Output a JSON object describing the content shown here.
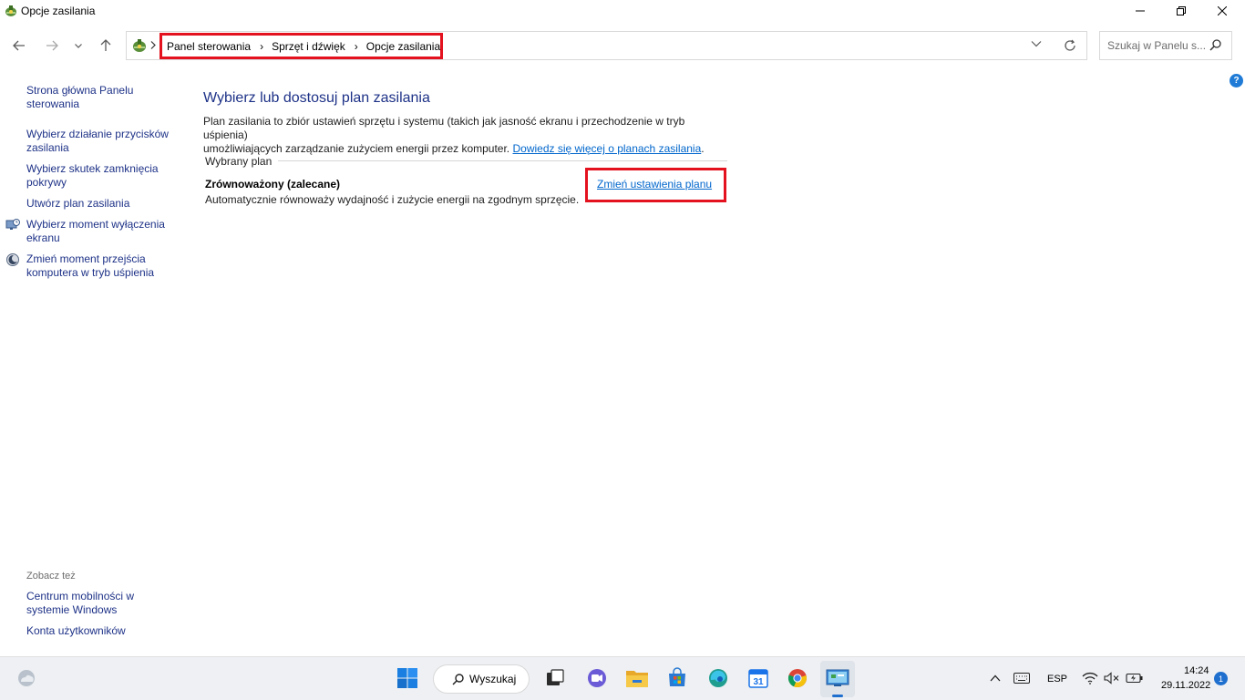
{
  "window": {
    "title": "Opcje zasilania",
    "app_icon": "power-options-icon",
    "controls": [
      "minimize-icon",
      "restore-icon",
      "close-icon"
    ]
  },
  "navigation": {
    "back": "back-arrow-icon",
    "forward": "forward-arrow-icon",
    "recent": "chevron-down-icon",
    "up": "up-arrow-icon"
  },
  "address": {
    "crumbs": [
      "Panel sterowania",
      "Sprzęt i dźwięk",
      "Opcje zasilania"
    ],
    "separator": "›",
    "highlight_color": "#e3121e"
  },
  "search": {
    "placeholder": "Szukaj w Panelu s..."
  },
  "help": {
    "label": "?"
  },
  "sidebar": {
    "items": [
      {
        "label_line1": "Strona główna Panelu",
        "label_line2": "sterowania",
        "icon": ""
      },
      {
        "label_line1": "Wybierz działanie przycisków",
        "label_line2": "zasilania",
        "icon": ""
      },
      {
        "label_line1": "Wybierz skutek zamknięcia",
        "label_line2": "pokrywy",
        "icon": ""
      },
      {
        "label_line1": "Utwórz plan zasilania",
        "label_line2": "",
        "icon": ""
      },
      {
        "label_line1": "Wybierz moment wyłączenia",
        "label_line2": "ekranu",
        "icon": "display-clock-icon"
      },
      {
        "label_line1": "Zmień moment przejścia",
        "label_line2": "komputera w tryb uśpienia",
        "icon": "sleep-moon-icon"
      }
    ],
    "see_also": "Zobacz też",
    "see_also_items": [
      {
        "label_line1": "Centrum mobilności w",
        "label_line2": "systemie Windows"
      },
      {
        "label_line1": "Konta użytkowników",
        "label_line2": ""
      }
    ]
  },
  "main": {
    "heading": "Wybierz lub dostosuj plan zasilania",
    "description_line1": "Plan zasilania to zbiór ustawień sprzętu i systemu (takich jak jasność ekranu i przechodzenie w tryb uśpienia)",
    "description_line2": "umożliwiających zarządzanie zużyciem energii przez komputer.",
    "learn_more": "Dowiedz się więcej o planach zasilania",
    "learn_more_suffix": ".",
    "group_label": "Wybrany plan",
    "plan": {
      "name": "Zrównoważony (zalecane)",
      "description": "Automatycznie równoważy wydajność i zużycie energii na zgodnym sprzęcie.",
      "change_link": "Zmień ustawienia planu"
    }
  },
  "taskbar": {
    "weather_icon": "weather-icon",
    "start_icon": "windows-start-icon",
    "search_label": "Wyszukaj",
    "apps": [
      "task-view-icon",
      "teams-chat-icon",
      "file-explorer-icon",
      "microsoft-store-icon",
      "edge-icon",
      "calendar-icon",
      "chrome-icon",
      "control-panel-icon"
    ],
    "calendar_day": "31",
    "tray": {
      "chevron": "chevron-up-icon",
      "keyboard": "keyboard-icon",
      "language": "ESP",
      "wifi": "wifi-icon",
      "volume": "volume-muted-icon",
      "battery": "battery-icon",
      "time": "14:24",
      "date": "29.11.2022",
      "notifications": "1"
    }
  }
}
